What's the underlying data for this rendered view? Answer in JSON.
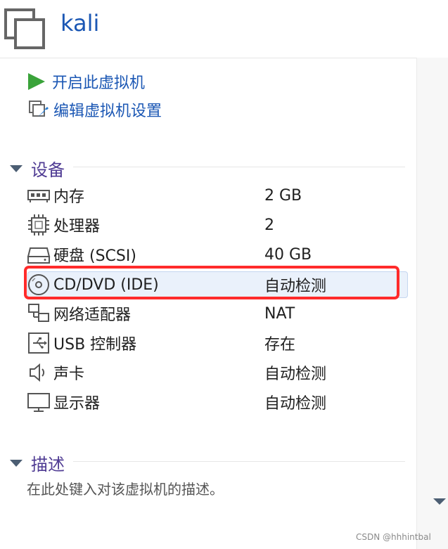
{
  "vm": {
    "name": "kali"
  },
  "actions": {
    "power_on": "开启此虚拟机",
    "edit_settings": "编辑虚拟机设置"
  },
  "devices": {
    "title": "设备",
    "items": [
      {
        "name": "内存",
        "value": "2 GB",
        "icon": "memory-icon"
      },
      {
        "name": "处理器",
        "value": "2",
        "icon": "cpu-icon"
      },
      {
        "name": "硬盘 (SCSI)",
        "value": "40 GB",
        "icon": "hard-disk-icon"
      },
      {
        "name": "CD/DVD (IDE)",
        "value": "自动检测",
        "icon": "cd-dvd-icon"
      },
      {
        "name": "网络适配器",
        "value": "NAT",
        "icon": "network-adapter-icon"
      },
      {
        "name": "USB 控制器",
        "value": "存在",
        "icon": "usb-icon"
      },
      {
        "name": "声卡",
        "value": "自动检测",
        "icon": "speaker-icon"
      },
      {
        "name": "显示器",
        "value": "自动检测",
        "icon": "monitor-icon"
      }
    ]
  },
  "description": {
    "title": "描述",
    "placeholder": "在此处键入对该虚拟机的描述。"
  },
  "watermark": "CSDN @hhhintbal",
  "colors": {
    "link": "#1b57b4",
    "section": "#4f3b93",
    "highlight": "#ff2b2b",
    "play": "#3aa33a"
  }
}
